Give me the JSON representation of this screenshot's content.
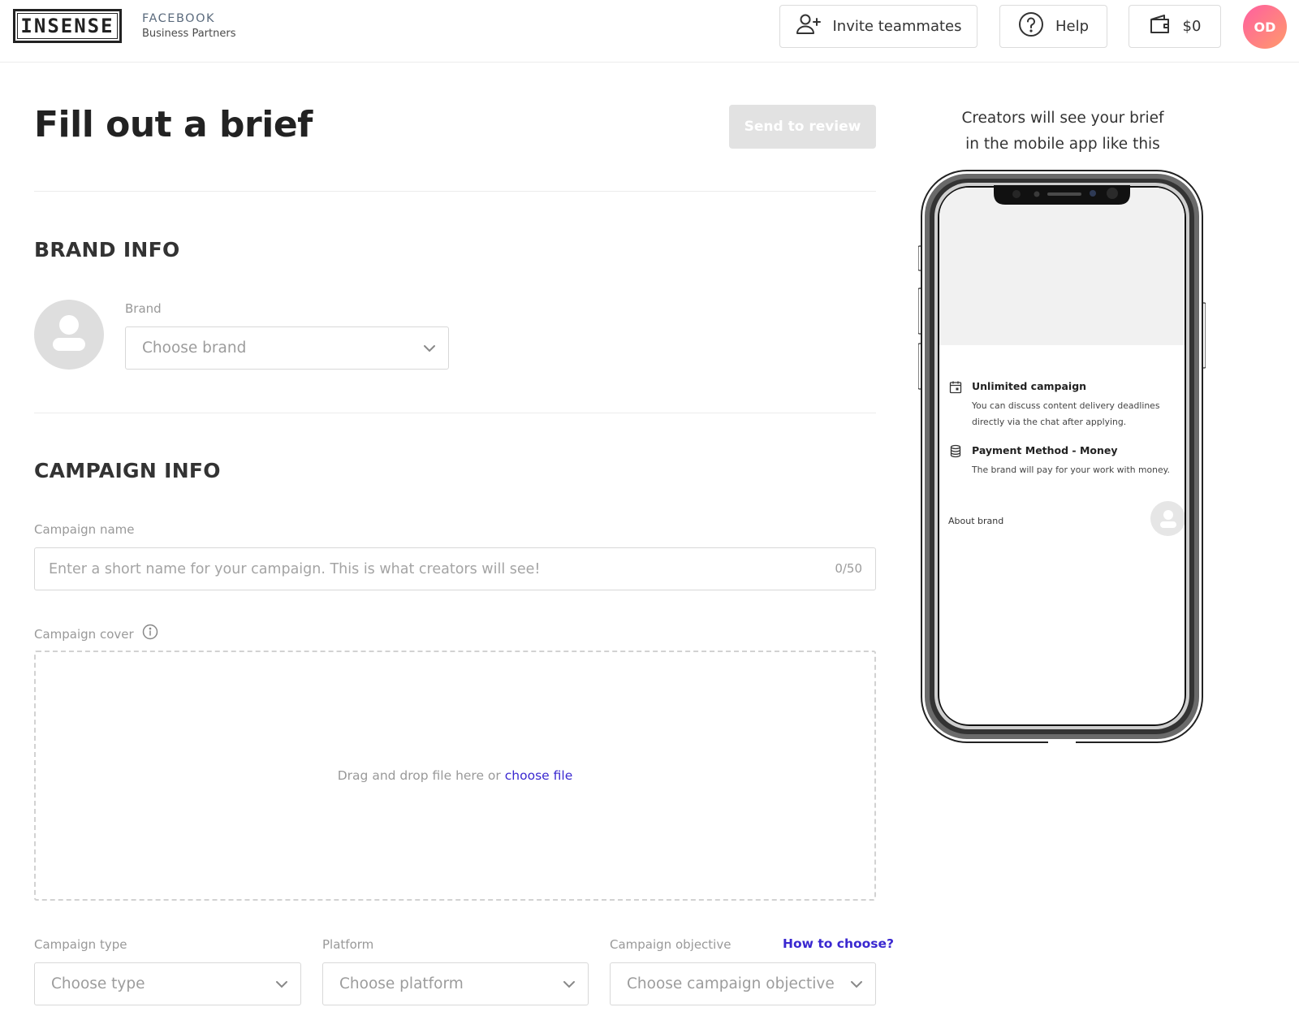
{
  "header": {
    "logo_text": "INSENSE",
    "partner_line1": "FACEBOOK",
    "partner_line2": "Business Partners",
    "invite_label": "Invite teammates",
    "help_label": "Help",
    "balance": "$0",
    "user_initials": "OD",
    "icons": [
      "add-user-icon",
      "help-circle-icon",
      "wallet-icon"
    ]
  },
  "page": {
    "title": "Fill out a brief",
    "send_label": "Send to review"
  },
  "brand_info": {
    "heading": "BRAND INFO",
    "brand_label": "Brand",
    "brand_placeholder": "Choose brand"
  },
  "campaign_info": {
    "heading": "CAMPAIGN INFO",
    "name_label": "Campaign name",
    "name_placeholder": "Enter a short name for your campaign. This is what creators will see!",
    "name_counter": "0/50",
    "cover_label": "Campaign cover",
    "dropzone_text": "Drag and drop file here or",
    "dropzone_link": "choose file",
    "type_label": "Campaign type",
    "type_placeholder": "Choose type",
    "platform_label": "Platform",
    "platform_placeholder": "Choose platform",
    "objective_label": "Campaign objective",
    "objective_help": "How to choose?",
    "objective_placeholder": "Choose campaign objective"
  },
  "preview": {
    "caption_line1": "Creators will see your brief",
    "caption_line2": "in the mobile app like this",
    "items": [
      {
        "icon": "calendar-icon",
        "title": "Unlimited campaign",
        "description": "You can discuss content delivery deadlines directly via the chat after applying."
      },
      {
        "icon": "coins-icon",
        "title": "Payment Method - Money",
        "description": "The brand will pay for your work with money."
      }
    ],
    "about_brand": "About brand"
  },
  "colors": {
    "accent_link": "#3a28d0",
    "disabled_button": "#e2e2e2",
    "avatar_gradient_start": "#ff5fa0",
    "avatar_gradient_end": "#ff9a6b"
  }
}
